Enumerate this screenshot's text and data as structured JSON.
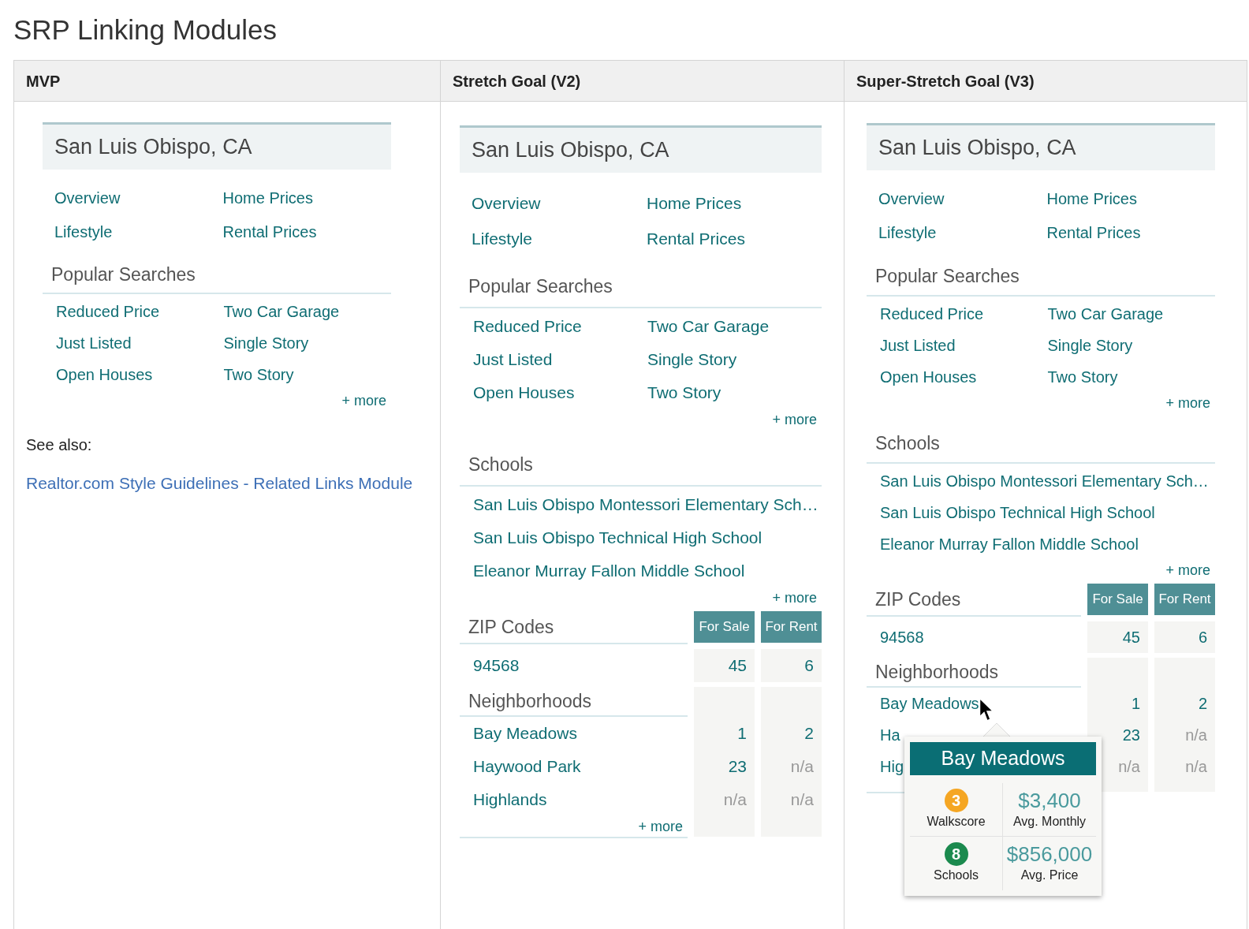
{
  "title": "SRP Linking Modules",
  "columns": [
    {
      "heading": "MVP",
      "module": {
        "location": "San Luis Obispo, CA",
        "nav_links": [
          "Overview",
          "Home Prices",
          "Lifestyle",
          "Rental Prices"
        ],
        "popular_searches": {
          "title": "Popular Searches",
          "links": [
            "Reduced Price",
            "Two Car Garage",
            "Just Listed",
            "Single Story",
            "Open Houses",
            "Two Story"
          ],
          "more": "+ more"
        }
      },
      "see_also": {
        "label": "See also:",
        "link": "Realtor.com Style Guidelines - Related Links Module"
      }
    },
    {
      "heading": "Stretch Goal (V2)",
      "module": {
        "location": "San Luis Obispo, CA",
        "nav_links": [
          "Overview",
          "Home Prices",
          "Lifestyle",
          "Rental Prices"
        ],
        "popular_searches": {
          "title": "Popular Searches",
          "links": [
            "Reduced Price",
            "Two Car Garage",
            "Just Listed",
            "Single Story",
            "Open Houses",
            "Two Story"
          ],
          "more": "+ more"
        },
        "schools": {
          "title": "Schools",
          "items": [
            "San Luis Obispo Montessori Elementary Sch…",
            "San Luis Obispo Technical High School",
            "Eleanor Murray Fallon Middle School"
          ],
          "more": "+ more"
        },
        "zip_codes": {
          "title": "ZIP Codes",
          "headers": [
            "For Sale",
            "For Rent"
          ],
          "rows": [
            {
              "name": "94568",
              "for_sale": {
                "value": "45",
                "available": true
              },
              "for_rent": {
                "value": "6",
                "available": true
              }
            }
          ]
        },
        "neighborhoods": {
          "title": "Neighborhoods",
          "rows": [
            {
              "name": "Bay Meadows",
              "for_sale": {
                "value": "1",
                "available": true
              },
              "for_rent": {
                "value": "2",
                "available": true
              }
            },
            {
              "name": "Haywood Park",
              "for_sale": {
                "value": "23",
                "available": true
              },
              "for_rent": {
                "value": "n/a",
                "available": false
              }
            },
            {
              "name": "Highlands",
              "for_sale": {
                "value": "n/a",
                "available": false
              },
              "for_rent": {
                "value": "n/a",
                "available": false
              }
            }
          ],
          "more": "+ more"
        }
      }
    },
    {
      "heading": "Super-Stretch Goal (V3)",
      "module": {
        "location": "San Luis Obispo, CA",
        "nav_links": [
          "Overview",
          "Home Prices",
          "Lifestyle",
          "Rental Prices"
        ],
        "popular_searches": {
          "title": "Popular Searches",
          "links": [
            "Reduced Price",
            "Two Car Garage",
            "Just Listed",
            "Single Story",
            "Open Houses",
            "Two Story"
          ],
          "more": "+ more"
        },
        "schools": {
          "title": "Schools",
          "items": [
            "San Luis Obispo Montessori Elementary Sch…",
            "San Luis Obispo Technical High School",
            "Eleanor Murray Fallon Middle School"
          ],
          "more": "+ more"
        },
        "zip_codes": {
          "title": "ZIP Codes",
          "headers": [
            "For Sale",
            "For Rent"
          ],
          "rows": [
            {
              "name": "94568",
              "for_sale": {
                "value": "45",
                "available": true
              },
              "for_rent": {
                "value": "6",
                "available": true
              }
            }
          ]
        },
        "neighborhoods": {
          "title": "Neighborhoods",
          "rows": [
            {
              "name": "Bay Meadows",
              "for_sale": {
                "value": "1",
                "available": true
              },
              "for_rent": {
                "value": "2",
                "available": true
              }
            },
            {
              "name": "Ha",
              "for_sale": {
                "value": "23",
                "available": true
              },
              "for_rent": {
                "value": "n/a",
                "available": false
              }
            },
            {
              "name": "Hig",
              "for_sale": {
                "value": "n/a",
                "available": false
              },
              "for_rent": {
                "value": "n/a",
                "available": false
              }
            }
          ],
          "popup": {
            "title": "Bay Meadows",
            "stats": [
              {
                "kind": "score",
                "value": "3",
                "label": "Walkscore",
                "color": "#f5a623"
              },
              {
                "kind": "amount",
                "value": "$3,400",
                "label": "Avg. Monthly"
              },
              {
                "kind": "score",
                "value": "8",
                "label": "Schools",
                "color": "#1b8a4e"
              },
              {
                "kind": "amount",
                "value": "$856,000",
                "label": "Avg. Price"
              }
            ]
          }
        }
      }
    }
  ]
}
